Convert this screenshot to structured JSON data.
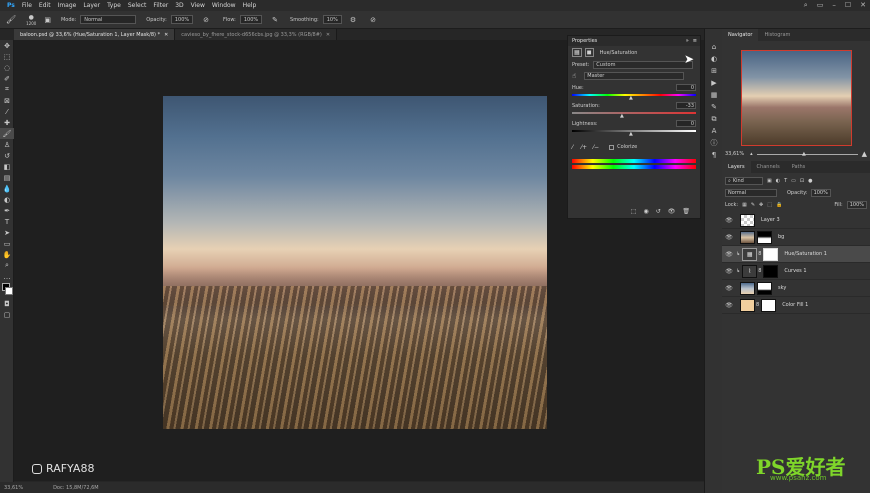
{
  "menubar": {
    "items": [
      "File",
      "Edit",
      "Image",
      "Layer",
      "Type",
      "Select",
      "Filter",
      "3D",
      "View",
      "Window",
      "Help"
    ]
  },
  "options": {
    "mode_label": "Mode:",
    "mode_value": "Normal",
    "opacity_label": "Opacity:",
    "opacity_value": "100%",
    "flow_label": "Flow:",
    "flow_value": "100%",
    "smoothing_label": "Smoothing:",
    "smoothing_value": "10%",
    "brush_size": "1200"
  },
  "tabs": [
    {
      "label": "baloon.psd @ 33,6% (Hue/Saturation 1, Layer Mask/8) *"
    },
    {
      "label": "cavieso_by_fhere_stock-d656cbs.jpg @ 33,3% (RGB/8#)"
    }
  ],
  "properties": {
    "tab_label": "Properties",
    "adjustment_name": "Hue/Saturation",
    "preset_label": "Preset:",
    "preset_value": "Custom",
    "channel_value": "Master",
    "hue_label": "Hue:",
    "hue_value": "0",
    "saturation_label": "Saturation:",
    "saturation_value": "-33",
    "lightness_label": "Lightness:",
    "lightness_value": "0",
    "colorize_label": "Colorize"
  },
  "navigator": {
    "tabs": [
      "Navigator",
      "Histogram"
    ],
    "zoom": "33,61%"
  },
  "layers": {
    "tabs": [
      "Layers",
      "Channels",
      "Paths"
    ],
    "kind_value": "Kind",
    "blend_value": "Normal",
    "opacity_label": "Opacity:",
    "opacity_value": "100%",
    "lock_label": "Lock:",
    "fill_label": "Fill:",
    "fill_value": "100%",
    "items": [
      {
        "name": "Layer 3"
      },
      {
        "name": "bg"
      },
      {
        "name": "Hue/Saturation 1"
      },
      {
        "name": "Curves 1"
      },
      {
        "name": "sky"
      },
      {
        "name": "Color Fill 1"
      }
    ]
  },
  "status": {
    "zoom": "33,61%",
    "doc": "Doc: 15,8M/72,6M"
  },
  "watermarks": {
    "author": "RAFYA88",
    "brand": "PS爱好者",
    "url": "www.psahz.com"
  }
}
